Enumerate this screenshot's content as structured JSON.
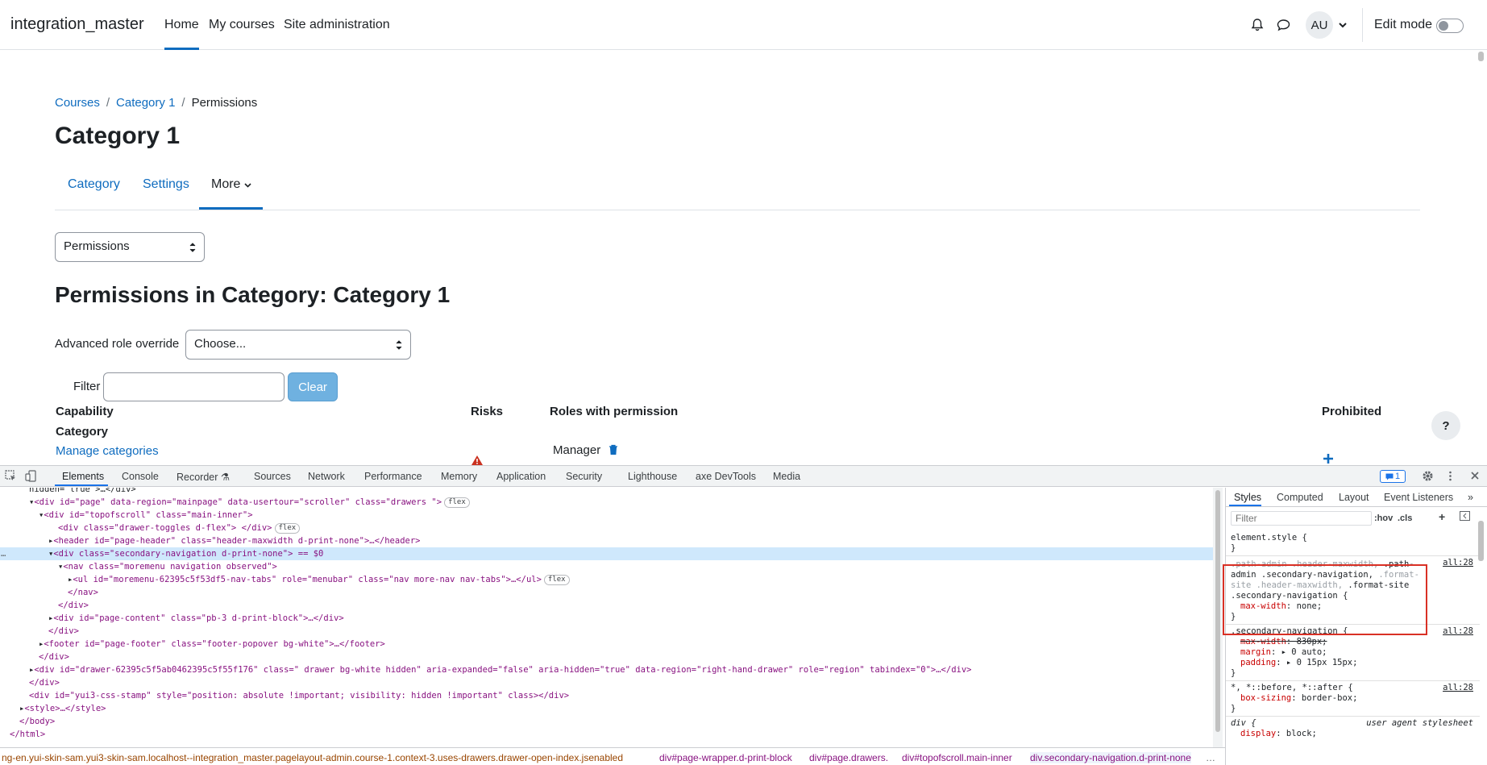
{
  "navbar": {
    "brand": "integration_master",
    "links": [
      "Home",
      "My courses",
      "Site administration"
    ],
    "avatar_initials": "AU",
    "edit_mode_label": "Edit mode"
  },
  "breadcrumb": [
    "Courses",
    "Category 1",
    "Permissions"
  ],
  "page_title": "Category 1",
  "secondary_nav": {
    "tabs": [
      "Category",
      "Settings",
      "More"
    ]
  },
  "permissions_select": "Permissions",
  "heading": "Permissions in Category: Category 1",
  "override": {
    "label": "Advanced role override",
    "value": "Choose..."
  },
  "filter": {
    "label": "Filter",
    "value": "",
    "clear_label": "Clear"
  },
  "table": {
    "headers": [
      "Capability",
      "Risks",
      "Roles with permission",
      "Prohibited"
    ],
    "group": "Category",
    "rows": [
      {
        "capability": "Manage categories",
        "roles": "Manager"
      }
    ]
  },
  "help_label": "?",
  "devtools": {
    "tabs": [
      "Elements",
      "Console",
      "Recorder",
      "Sources",
      "Network",
      "Performance",
      "Memory",
      "Application",
      "Security",
      "Lighthouse",
      "axe DevTools",
      "Media"
    ],
    "issues_count": "1",
    "dom_lines": [
      "hidden=\"true\">…</div>",
      "<div id=\"page\" data-region=\"mainpage\" data-usertour=\"scroller\" class=\"drawers  \">",
      "<div id=\"topofscroll\" class=\"main-inner\">",
      "<div class=\"drawer-toggles d-flex\"> </div>",
      "<header id=\"page-header\" class=\"header-maxwidth d-print-none\">…</header>",
      "<div class=\"secondary-navigation d-print-none\"> == $0",
      "<nav class=\"moremenu navigation observed\">",
      "<ul id=\"moremenu-62395c5f53df5-nav-tabs\" role=\"menubar\" class=\"nav more-nav nav-tabs\">…</ul>",
      "</nav>",
      "</div>",
      "<div id=\"page-content\" class=\"pb-3 d-print-block\">…</div>",
      "</div>",
      "<footer id=\"page-footer\" class=\"footer-popover bg-white\">…</footer>",
      "</div>",
      "<div id=\"drawer-62395c5f5ab0462395c5f55f176\" class=\" drawer bg-white hidden\" aria-expanded=\"false\" aria-hidden=\"true\" data-region=\"right-hand-drawer\" role=\"region\" tabindex=\"0\">…</div>",
      "</div>",
      "<div id=\"yui3-css-stamp\" style=\"position: absolute !important; visibility: hidden !important\" class></div>",
      "<style>…</style>",
      "</body>",
      "</html>"
    ],
    "pill_flex": "flex",
    "crumbs": [
      "ng-en.yui-skin-sam.yui3-skin-sam.localhost--integration_master.pagelayout-admin.course-1.context-3.uses-drawers.drawer-open-index.jsenabled",
      "div#page-wrapper.d-print-block",
      "div#page.drawers.",
      "div#topofscroll.main-inner",
      "div.secondary-navigation.d-print-none"
    ],
    "styles": {
      "tabs": [
        "Styles",
        "Computed",
        "Layout",
        "Event Listeners"
      ],
      "filter_placeholder": "Filter",
      "hov": ":hov",
      "cls": ".cls",
      "element_style": "element.style {",
      "close_brace": "}",
      "source": "all:28",
      "rule1_selector_dim1": ".path-admin .header-maxwidth, ",
      "rule1_selector_strong1": ".path-admin .secondary-navigation, ",
      "rule1_selector_dim2": ".format-site .header-maxwidth, ",
      "rule1_selector_strong2": ".format-site .secondary-navigation {",
      "rule1_prop": "max-width",
      "rule1_val": "none;",
      "rule2_selector": ".secondary-navigation {",
      "rule2_props": [
        {
          "prop": "max-width",
          "val": "830px;"
        },
        {
          "prop": "margin",
          "val": "▸ 0 auto;"
        },
        {
          "prop": "padding",
          "val": "▸ 0 15px 15px;"
        }
      ],
      "rule3_selector": "*, *::before, *::after {",
      "rule3_prop": "box-sizing",
      "rule3_val": "border-box;",
      "rule4_selector": "div {",
      "rule4_source": "user agent stylesheet",
      "rule4_prop": "display",
      "rule4_val": "block;"
    }
  }
}
